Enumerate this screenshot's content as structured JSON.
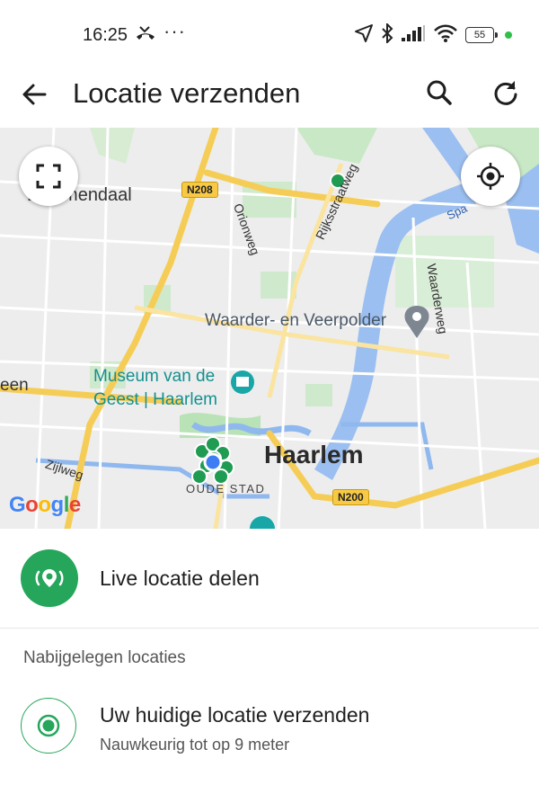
{
  "status_bar": {
    "time": "16:25",
    "overflow_dots": "···",
    "battery_level": "55",
    "icons": [
      "missed-call-icon",
      "location-arrow-icon",
      "bluetooth-icon",
      "signal-icon",
      "wifi-icon",
      "battery-icon"
    ]
  },
  "app_bar": {
    "title": "Locatie verzenden",
    "back_icon": "arrow-back-icon",
    "search_icon": "search-icon",
    "refresh_icon": "refresh-icon"
  },
  "map": {
    "labels": {
      "bloemendaal": "Bloemendaal",
      "n208": "N208",
      "orionweg": "Orionweg",
      "rijksstraatweg": "Rijksstraatweg",
      "spaarne": "Spa",
      "waarderweg": "Waarderweg",
      "waarder": "Waarder- en Veerpolder",
      "museum_line1": "Museum van de",
      "museum_line2": "Geest | Haarlem",
      "een": "een",
      "haarlem": "Haarlem",
      "zijlweg": "Zijlweg",
      "oude_stad": "OUDE STAD",
      "n200": "N200",
      "google": "Google"
    },
    "google_colors": [
      "#4285F4",
      "#EA4335",
      "#FBBC05",
      "#4285F4",
      "#34A853",
      "#EA4335"
    ]
  },
  "live_share": {
    "label": "Live locatie delen",
    "icon": "live-location-icon",
    "color": "#25a65b"
  },
  "nearby": {
    "title": "Nabijgelegen locaties",
    "current": {
      "title": "Uw huidige locatie verzenden",
      "subtitle": "Nauwkeurig tot op 9 meter",
      "icon": "radio-location-icon"
    }
  }
}
